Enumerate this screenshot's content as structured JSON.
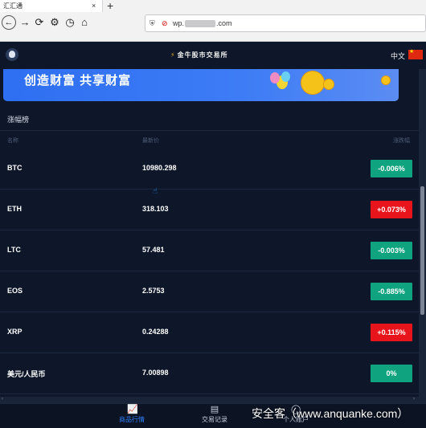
{
  "browser": {
    "tab_title": "汇汇通",
    "tab_close": "×",
    "new_tab": "+",
    "url_prefix": "wp.",
    "url_suffix": ".com"
  },
  "header": {
    "logo_text": "金牛股市交易所",
    "language": "中文"
  },
  "banner": {
    "slogan": "创造财富 共享财富"
  },
  "ranking": {
    "title": "涨幅榜",
    "columns": {
      "name": "名称",
      "price": "最新价",
      "change": "涨跌幅"
    },
    "rows": [
      {
        "name": "BTC",
        "price": "10980.298",
        "change": "-0.006%",
        "color": "#0fa37f"
      },
      {
        "name": "ETH",
        "price": "318.103",
        "change": "+0.073%",
        "color": "#e8141c"
      },
      {
        "name": "LTC",
        "price": "57.481",
        "change": "-0.003%",
        "color": "#0fa37f"
      },
      {
        "name": "EOS",
        "price": "2.5753",
        "change": "-0.885%",
        "color": "#0fa37f"
      },
      {
        "name": "XRP",
        "price": "0.24288",
        "change": "+0.115%",
        "color": "#e8141c"
      },
      {
        "name": "美元/人民币",
        "price": "7.00898",
        "change": "0%",
        "color": "#0fa37f"
      }
    ]
  },
  "tabbar": {
    "market": "商品行情",
    "records": "交易记录",
    "account": "个人账户"
  },
  "watermark": "安全客（www.anquanke.com）",
  "colors": {
    "background": "#0e1729",
    "up": "#e8141c",
    "down": "#0fa37f",
    "accent": "#2f7cf6"
  }
}
